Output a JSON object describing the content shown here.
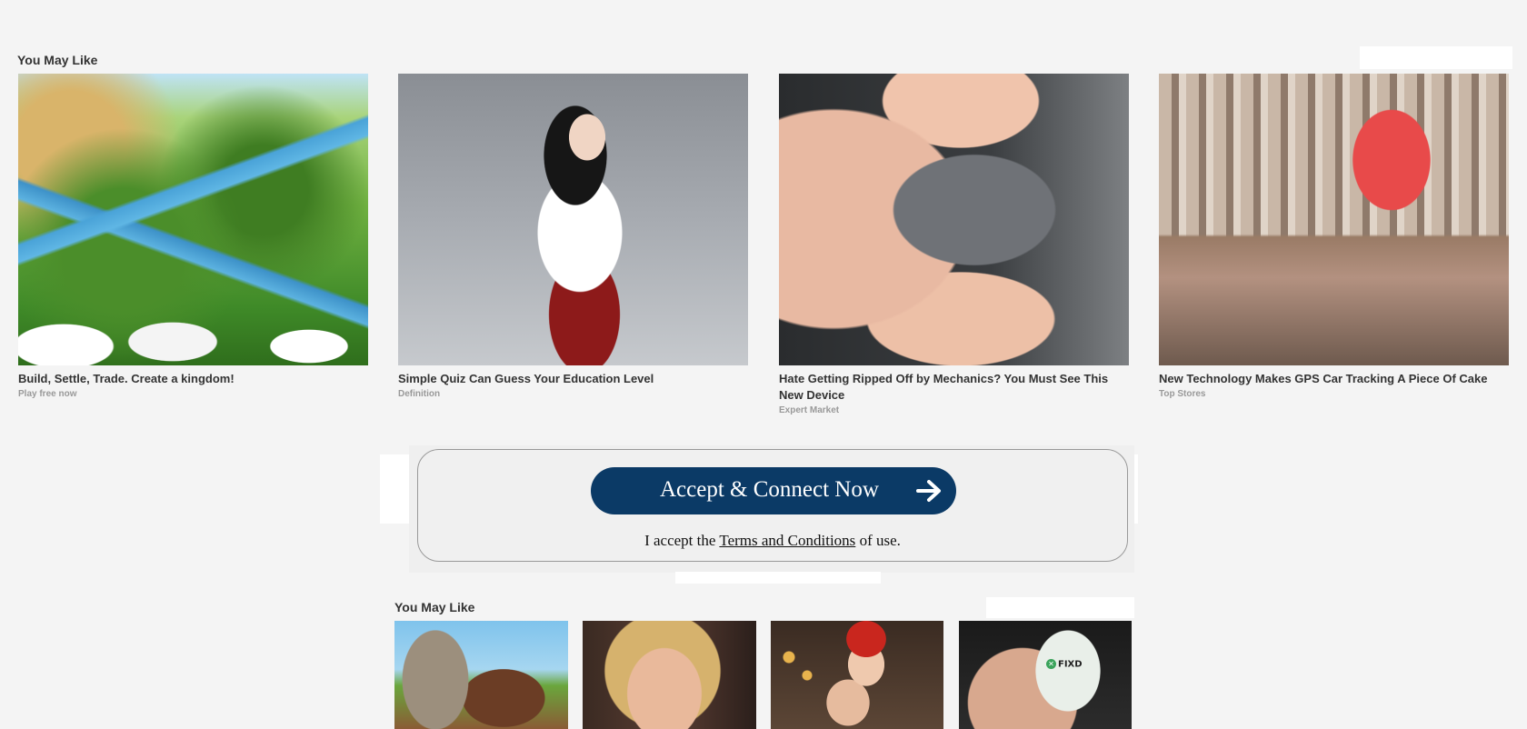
{
  "section1": {
    "title": "You May Like",
    "cards": [
      {
        "title": "Build, Settle, Trade. Create a kingdom!",
        "source": "Play free now",
        "image": "fantasy-kingdom-map"
      },
      {
        "title": "Simple Quiz Can Guess Your Education Level",
        "source": "Definition",
        "image": "woman-school-uniform"
      },
      {
        "title": "Hate Getting Ripped Off by Mechanics? You Must See This New Device",
        "source": "Expert Market",
        "image": "obd-connector-in-hand"
      },
      {
        "title": "New Technology Makes GPS Car Tracking A Piece Of Cake",
        "source": "Top Stores",
        "image": "city-with-map-pin"
      }
    ]
  },
  "consent": {
    "button_label": "Accept & Connect Now",
    "accept_prefix": "I accept the",
    "terms_link": "Terms and Conditions",
    "accept_suffix": "of use."
  },
  "section2": {
    "title": "You May Like",
    "cards": [
      {
        "image": "medieval-village"
      },
      {
        "image": "blonde-woman"
      },
      {
        "image": "smiling-couple"
      },
      {
        "image": "fixd-device",
        "logo_text": "FIXD"
      }
    ]
  }
}
